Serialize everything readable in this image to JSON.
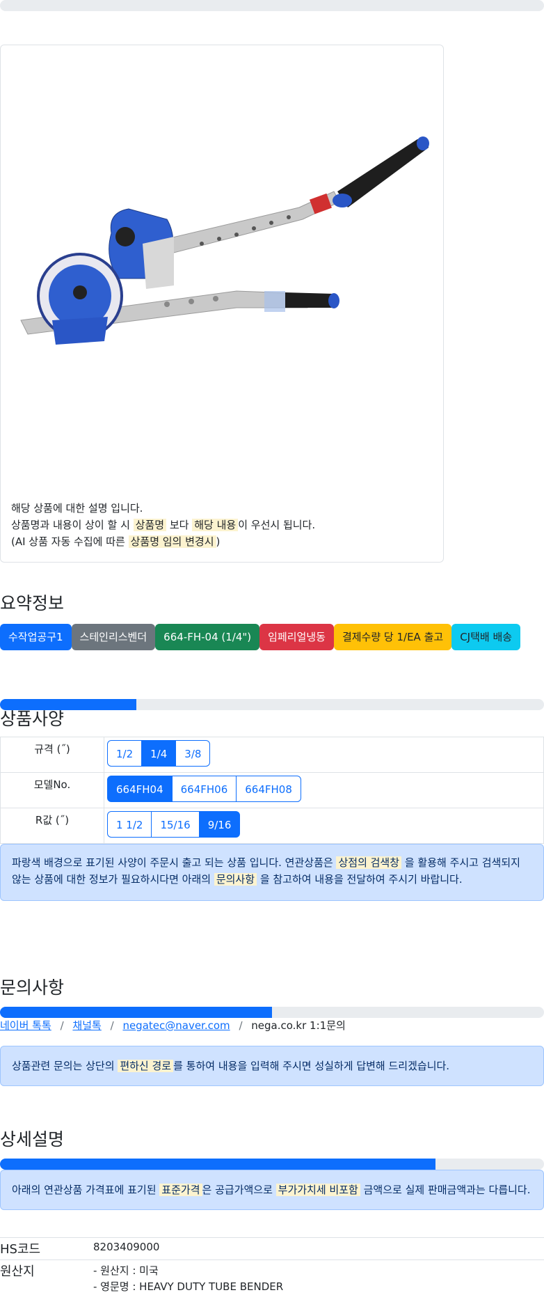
{
  "product_note": {
    "line1": "해당 상품에 대한 설명 입니다.",
    "line2_a": "상품명과 내용이 상이 할 시",
    "line2_mark1": "상품명",
    "line2_b": "보다",
    "line2_mark2": "해당 내용",
    "line2_c": "이 우선시 됩니다.",
    "line3_a": "(AI 상품 자동 수집에 따른",
    "line3_mark": "상품명 임의 변경시",
    "line3_b": ")"
  },
  "summary": {
    "title": "요약정보",
    "badges": [
      {
        "label": "수작업공구1",
        "color": "#0d6efd"
      },
      {
        "label": "스테인리스벤더",
        "color": "#6c757d"
      },
      {
        "label": "664-FH-04 (1/4\")",
        "color": "#198754"
      },
      {
        "label": "임페리얼냉동",
        "color": "#dc3545"
      },
      {
        "label": "결제수량 당 1/EA 출고",
        "color": "#ffc107"
      },
      {
        "label": "CJ택배 배송",
        "color": "#0dcaf0"
      }
    ]
  },
  "spec": {
    "title": "상품사양",
    "progress": 0.25,
    "rows": [
      {
        "label": "규격 (˝)",
        "options": [
          "1/2",
          "1/4",
          "3/8"
        ],
        "active": 1
      },
      {
        "label": "모델No.",
        "options": [
          "664FH04",
          "664FH06",
          "664FH08"
        ],
        "active": 0
      },
      {
        "label": "R값 (˝)",
        "options": [
          "1 1/2",
          "15/16",
          "9/16"
        ],
        "active": 2
      }
    ],
    "notice_a": "파랑색 배경으로 표기된 사양이 주문시 출고 되는 상품 입니다. 연관상품은",
    "notice_mark1": "상점의 검색창",
    "notice_b": "을 활용해 주시고 검색되지 않는 상품에 대한 정보가 필요하시다면 아래의",
    "notice_mark2": "문의사항",
    "notice_c": "을 참고하여 내용을 전달하여 주시기 바랍니다."
  },
  "inquiry": {
    "title": "문의사항",
    "progress": 0.5,
    "links": [
      "네이버 톡톡",
      "채널톡",
      "negatec@naver.com"
    ],
    "plain": "nega.co.kr 1:1문의",
    "separator": "/",
    "notice_a": "상품관련 문의는 상단의",
    "notice_mark": "편하신 경로",
    "notice_b": "를 통하여 내용을 입력해 주시면 성실하게 답변해 드리겠습니다."
  },
  "detail": {
    "title": "상세설명",
    "progress": 0.8,
    "notice_a": "아래의 연관상품 가격표에 표기된",
    "notice_mark1": "표준가격",
    "notice_b": "은 공급가액으로",
    "notice_mark2": "부가가치세 비포함",
    "notice_c": "금액으로 실제 판매금액과는 다릅니다.",
    "hs_label": "HS코드",
    "hs_value": "8203409000",
    "origin_label": "원산지",
    "origin_line1": "- 원산지 : 미국",
    "origin_line2": "- 영문명 : HEAVY DUTY TUBE BENDER"
  }
}
